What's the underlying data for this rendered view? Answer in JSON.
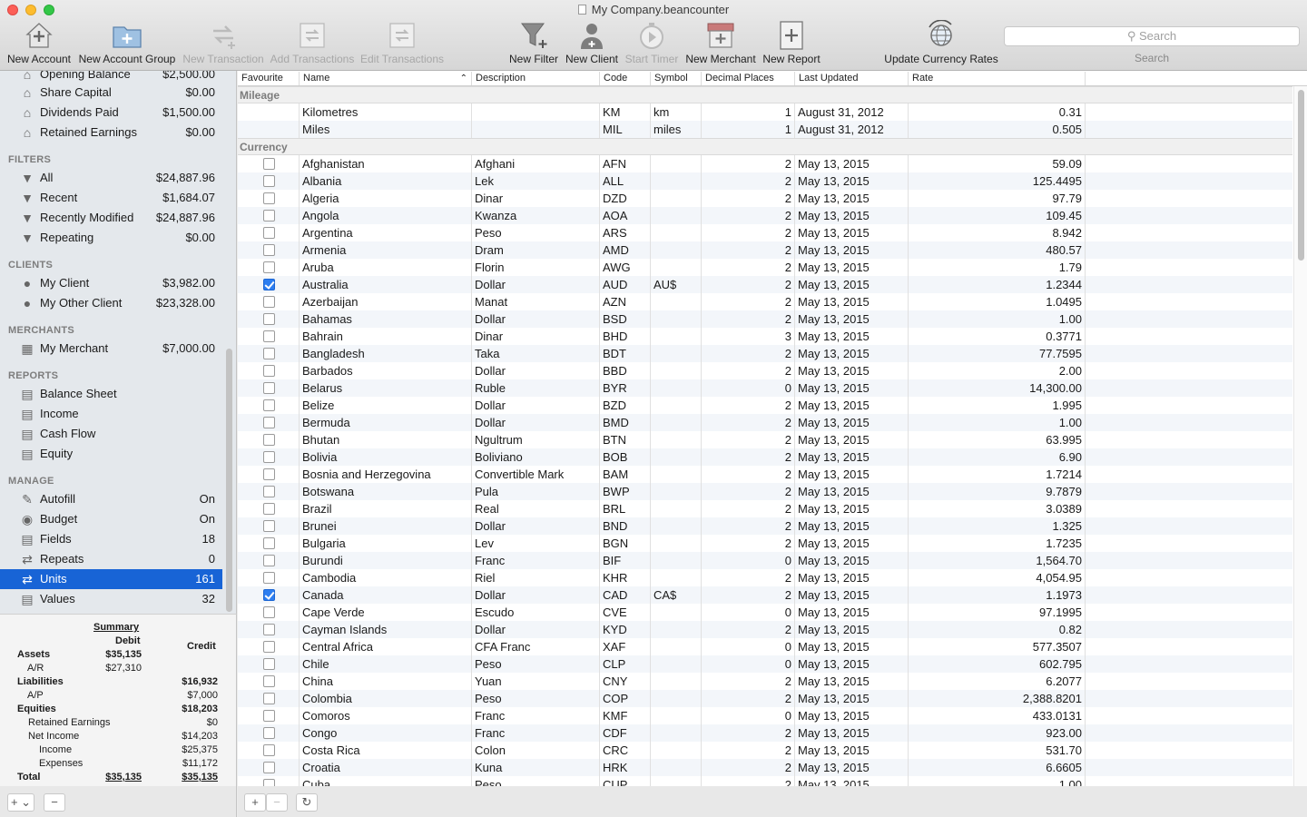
{
  "window": {
    "title": "My Company.beancounter"
  },
  "toolbar": {
    "new_account": "New Account",
    "new_account_group": "New Account Group",
    "new_transaction": "New Transaction",
    "add_transactions": "Add Transactions",
    "edit_transactions": "Edit Transactions",
    "new_filter": "New Filter",
    "new_client": "New Client",
    "start_timer": "Start Timer",
    "new_merchant": "New Merchant",
    "new_report": "New Report",
    "update_rates": "Update Currency Rates",
    "search_placeholder": "Search",
    "search_label": "Search"
  },
  "sidebar": {
    "accounts": [
      {
        "label": "Opening Balance",
        "value": "$2,500.00"
      },
      {
        "label": "Share Capital",
        "value": "$0.00"
      },
      {
        "label": "Dividends Paid",
        "value": "$1,500.00"
      },
      {
        "label": "Retained Earnings",
        "value": "$0.00"
      }
    ],
    "filters_head": "FILTERS",
    "filters": [
      {
        "label": "All",
        "value": "$24,887.96"
      },
      {
        "label": "Recent",
        "value": "$1,684.07"
      },
      {
        "label": "Recently Modified",
        "value": "$24,887.96"
      },
      {
        "label": "Repeating",
        "value": "$0.00"
      }
    ],
    "clients_head": "CLIENTS",
    "clients": [
      {
        "label": "My Client",
        "value": "$3,982.00"
      },
      {
        "label": "My Other Client",
        "value": "$23,328.00"
      }
    ],
    "merchants_head": "MERCHANTS",
    "merchants": [
      {
        "label": "My Merchant",
        "value": "$7,000.00"
      }
    ],
    "reports_head": "REPORTS",
    "reports": [
      {
        "label": "Balance Sheet"
      },
      {
        "label": "Income"
      },
      {
        "label": "Cash Flow"
      },
      {
        "label": "Equity"
      }
    ],
    "manage_head": "MANAGE",
    "manage": [
      {
        "label": "Autofill",
        "value": "On"
      },
      {
        "label": "Budget",
        "value": "On"
      },
      {
        "label": "Fields",
        "value": "18"
      },
      {
        "label": "Repeats",
        "value": "0"
      },
      {
        "label": "Units",
        "value": "161"
      },
      {
        "label": "Values",
        "value": "32"
      }
    ]
  },
  "summary": {
    "title": "Summary",
    "debit": "Debit",
    "credit": "Credit",
    "rows": [
      {
        "label": "Assets",
        "debit": "$35,135",
        "credit": ""
      },
      {
        "label": "A/R",
        "debit": "$27,310",
        "credit": ""
      },
      {
        "label": "Liabilities",
        "debit": "",
        "credit": "$16,932"
      },
      {
        "label": "A/P",
        "debit": "",
        "credit": "$7,000"
      },
      {
        "label": "Equities",
        "debit": "",
        "credit": "$18,203"
      },
      {
        "label": "Retained Earnings",
        "debit": "",
        "credit": "$0"
      },
      {
        "label": "Net Income",
        "debit": "",
        "credit": "$14,203"
      },
      {
        "label": "Income",
        "debit": "",
        "credit": "$25,375"
      },
      {
        "label": "Expenses",
        "debit": "",
        "credit": "$11,172"
      },
      {
        "label": "Total",
        "debit": "$35,135",
        "credit": "$35,135"
      }
    ]
  },
  "table": {
    "columns": [
      "Favourite",
      "Name",
      "Description",
      "Code",
      "Symbol",
      "Decimal Places",
      "Last Updated",
      "Rate"
    ],
    "sort_indicator": "^",
    "mileage_group": "Mileage",
    "mileage": [
      {
        "name": "Kilometres",
        "desc": "",
        "code": "KM",
        "symbol": "km",
        "dp": "1",
        "updated": "August 31, 2012",
        "rate": "0.31"
      },
      {
        "name": "Miles",
        "desc": "",
        "code": "MIL",
        "symbol": "miles",
        "dp": "1",
        "updated": "August 31, 2012",
        "rate": "0.505"
      }
    ],
    "currency_group": "Currency",
    "currency": [
      {
        "fav": false,
        "name": "Afghanistan",
        "desc": "Afghani",
        "code": "AFN",
        "symbol": "",
        "dp": "2",
        "updated": "May 13, 2015",
        "rate": "59.09"
      },
      {
        "fav": false,
        "name": "Albania",
        "desc": "Lek",
        "code": "ALL",
        "symbol": "",
        "dp": "2",
        "updated": "May 13, 2015",
        "rate": "125.4495"
      },
      {
        "fav": false,
        "name": "Algeria",
        "desc": "Dinar",
        "code": "DZD",
        "symbol": "",
        "dp": "2",
        "updated": "May 13, 2015",
        "rate": "97.79"
      },
      {
        "fav": false,
        "name": "Angola",
        "desc": "Kwanza",
        "code": "AOA",
        "symbol": "",
        "dp": "2",
        "updated": "May 13, 2015",
        "rate": "109.45"
      },
      {
        "fav": false,
        "name": "Argentina",
        "desc": "Peso",
        "code": "ARS",
        "symbol": "",
        "dp": "2",
        "updated": "May 13, 2015",
        "rate": "8.942"
      },
      {
        "fav": false,
        "name": "Armenia",
        "desc": "Dram",
        "code": "AMD",
        "symbol": "",
        "dp": "2",
        "updated": "May 13, 2015",
        "rate": "480.57"
      },
      {
        "fav": false,
        "name": "Aruba",
        "desc": "Florin",
        "code": "AWG",
        "symbol": "",
        "dp": "2",
        "updated": "May 13, 2015",
        "rate": "1.79"
      },
      {
        "fav": true,
        "name": "Australia",
        "desc": "Dollar",
        "code": "AUD",
        "symbol": "AU$",
        "dp": "2",
        "updated": "May 13, 2015",
        "rate": "1.2344"
      },
      {
        "fav": false,
        "name": "Azerbaijan",
        "desc": "Manat",
        "code": "AZN",
        "symbol": "",
        "dp": "2",
        "updated": "May 13, 2015",
        "rate": "1.0495"
      },
      {
        "fav": false,
        "name": "Bahamas",
        "desc": "Dollar",
        "code": "BSD",
        "symbol": "",
        "dp": "2",
        "updated": "May 13, 2015",
        "rate": "1.00"
      },
      {
        "fav": false,
        "name": "Bahrain",
        "desc": "Dinar",
        "code": "BHD",
        "symbol": "",
        "dp": "3",
        "updated": "May 13, 2015",
        "rate": "0.3771"
      },
      {
        "fav": false,
        "name": "Bangladesh",
        "desc": "Taka",
        "code": "BDT",
        "symbol": "",
        "dp": "2",
        "updated": "May 13, 2015",
        "rate": "77.7595"
      },
      {
        "fav": false,
        "name": "Barbados",
        "desc": "Dollar",
        "code": "BBD",
        "symbol": "",
        "dp": "2",
        "updated": "May 13, 2015",
        "rate": "2.00"
      },
      {
        "fav": false,
        "name": "Belarus",
        "desc": "Ruble",
        "code": "BYR",
        "symbol": "",
        "dp": "0",
        "updated": "May 13, 2015",
        "rate": "14,300.00"
      },
      {
        "fav": false,
        "name": "Belize",
        "desc": "Dollar",
        "code": "BZD",
        "symbol": "",
        "dp": "2",
        "updated": "May 13, 2015",
        "rate": "1.995"
      },
      {
        "fav": false,
        "name": "Bermuda",
        "desc": "Dollar",
        "code": "BMD",
        "symbol": "",
        "dp": "2",
        "updated": "May 13, 2015",
        "rate": "1.00"
      },
      {
        "fav": false,
        "name": "Bhutan",
        "desc": "Ngultrum",
        "code": "BTN",
        "symbol": "",
        "dp": "2",
        "updated": "May 13, 2015",
        "rate": "63.995"
      },
      {
        "fav": false,
        "name": "Bolivia",
        "desc": "Boliviano",
        "code": "BOB",
        "symbol": "",
        "dp": "2",
        "updated": "May 13, 2015",
        "rate": "6.90"
      },
      {
        "fav": false,
        "name": "Bosnia and Herzegovina",
        "desc": "Convertible Mark",
        "code": "BAM",
        "symbol": "",
        "dp": "2",
        "updated": "May 13, 2015",
        "rate": "1.7214"
      },
      {
        "fav": false,
        "name": "Botswana",
        "desc": "Pula",
        "code": "BWP",
        "symbol": "",
        "dp": "2",
        "updated": "May 13, 2015",
        "rate": "9.7879"
      },
      {
        "fav": false,
        "name": "Brazil",
        "desc": "Real",
        "code": "BRL",
        "symbol": "",
        "dp": "2",
        "updated": "May 13, 2015",
        "rate": "3.0389"
      },
      {
        "fav": false,
        "name": "Brunei",
        "desc": "Dollar",
        "code": "BND",
        "symbol": "",
        "dp": "2",
        "updated": "May 13, 2015",
        "rate": "1.325"
      },
      {
        "fav": false,
        "name": "Bulgaria",
        "desc": "Lev",
        "code": "BGN",
        "symbol": "",
        "dp": "2",
        "updated": "May 13, 2015",
        "rate": "1.7235"
      },
      {
        "fav": false,
        "name": "Burundi",
        "desc": "Franc",
        "code": "BIF",
        "symbol": "",
        "dp": "0",
        "updated": "May 13, 2015",
        "rate": "1,564.70"
      },
      {
        "fav": false,
        "name": "Cambodia",
        "desc": "Riel",
        "code": "KHR",
        "symbol": "",
        "dp": "2",
        "updated": "May 13, 2015",
        "rate": "4,054.95"
      },
      {
        "fav": true,
        "name": "Canada",
        "desc": "Dollar",
        "code": "CAD",
        "symbol": "CA$",
        "dp": "2",
        "updated": "May 13, 2015",
        "rate": "1.1973"
      },
      {
        "fav": false,
        "name": "Cape Verde",
        "desc": "Escudo",
        "code": "CVE",
        "symbol": "",
        "dp": "0",
        "updated": "May 13, 2015",
        "rate": "97.1995"
      },
      {
        "fav": false,
        "name": "Cayman Islands",
        "desc": "Dollar",
        "code": "KYD",
        "symbol": "",
        "dp": "2",
        "updated": "May 13, 2015",
        "rate": "0.82"
      },
      {
        "fav": false,
        "name": "Central Africa",
        "desc": "CFA Franc",
        "code": "XAF",
        "symbol": "",
        "dp": "0",
        "updated": "May 13, 2015",
        "rate": "577.3507"
      },
      {
        "fav": false,
        "name": "Chile",
        "desc": "Peso",
        "code": "CLP",
        "symbol": "",
        "dp": "0",
        "updated": "May 13, 2015",
        "rate": "602.795"
      },
      {
        "fav": false,
        "name": "China",
        "desc": "Yuan",
        "code": "CNY",
        "symbol": "",
        "dp": "2",
        "updated": "May 13, 2015",
        "rate": "6.2077"
      },
      {
        "fav": false,
        "name": "Colombia",
        "desc": "Peso",
        "code": "COP",
        "symbol": "",
        "dp": "2",
        "updated": "May 13, 2015",
        "rate": "2,388.8201"
      },
      {
        "fav": false,
        "name": "Comoros",
        "desc": "Franc",
        "code": "KMF",
        "symbol": "",
        "dp": "0",
        "updated": "May 13, 2015",
        "rate": "433.0131"
      },
      {
        "fav": false,
        "name": "Congo",
        "desc": "Franc",
        "code": "CDF",
        "symbol": "",
        "dp": "2",
        "updated": "May 13, 2015",
        "rate": "923.00"
      },
      {
        "fav": false,
        "name": "Costa Rica",
        "desc": "Colon",
        "code": "CRC",
        "symbol": "",
        "dp": "2",
        "updated": "May 13, 2015",
        "rate": "531.70"
      },
      {
        "fav": false,
        "name": "Croatia",
        "desc": "Kuna",
        "code": "HRK",
        "symbol": "",
        "dp": "2",
        "updated": "May 13, 2015",
        "rate": "6.6605"
      },
      {
        "fav": false,
        "name": "Cuba",
        "desc": "Peso",
        "code": "CUP",
        "symbol": "",
        "dp": "2",
        "updated": "May 13, 2015",
        "rate": "1.00"
      }
    ]
  },
  "bottom": {
    "add": "+",
    "remove": "−",
    "refresh": "↻",
    "menu": "+ ⌄"
  }
}
